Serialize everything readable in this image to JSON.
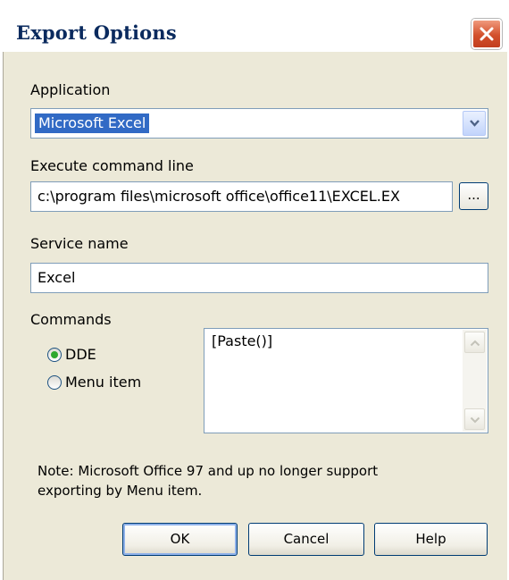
{
  "window": {
    "title": "Export Options"
  },
  "application": {
    "label": "Application",
    "selected": "Microsoft Excel"
  },
  "command_line": {
    "label": "Execute command line",
    "value": "c:\\program files\\microsoft office\\office11\\EXCEL.EX",
    "browse_label": "..."
  },
  "service": {
    "label": "Service name",
    "value": "Excel"
  },
  "commands": {
    "label": "Commands",
    "options": [
      {
        "label": "DDE",
        "checked": true
      },
      {
        "label": "Menu item",
        "checked": false
      }
    ],
    "text": "[Paste()]"
  },
  "note": {
    "line1": "Note: Microsoft Office 97 and up no longer support",
    "line2": "exporting by Menu item."
  },
  "buttons": {
    "ok": "OK",
    "cancel": "Cancel",
    "help": "Help"
  }
}
